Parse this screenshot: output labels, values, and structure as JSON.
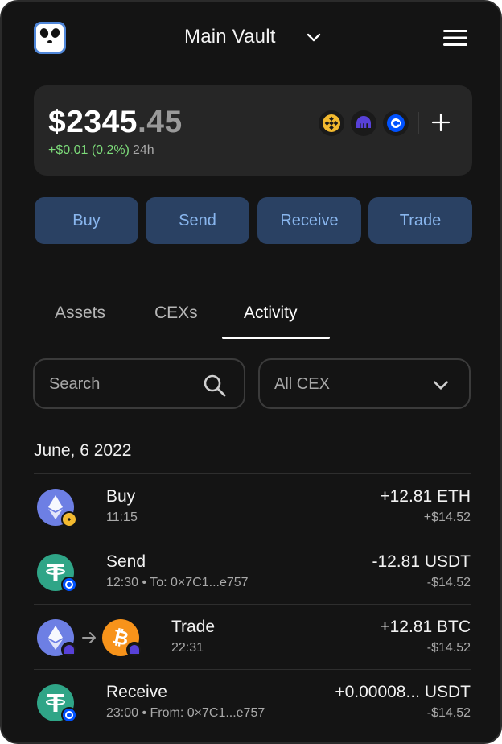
{
  "header": {
    "title": "Main Vault",
    "logo_icon": "panda-logo-icon",
    "menu_icon": "hamburger-menu-icon"
  },
  "balance": {
    "whole": "$2345",
    "cents": ".45",
    "change": "+$0.01 (0.2%)",
    "period": "24h",
    "exchanges": [
      "binance-icon",
      "kraken-icon",
      "coinbase-icon"
    ]
  },
  "actions": {
    "buy": "Buy",
    "send": "Send",
    "receive": "Receive",
    "trade": "Trade"
  },
  "tabs": [
    {
      "label": "Assets"
    },
    {
      "label": "CEXs"
    },
    {
      "label": "Activity",
      "active": true
    }
  ],
  "filters": {
    "search_placeholder": "Search",
    "cex_selected": "All CEX"
  },
  "activity": {
    "date": "June, 6 2022",
    "items": [
      {
        "type": "Buy",
        "time": "11:15",
        "amount": "+12.81 ETH",
        "fiat": "+$14.52",
        "coin": "ethereum-icon",
        "exchange": "binance-icon"
      },
      {
        "type": "Send",
        "time": "12:30 • To: 0×7C1...e757",
        "amount": "-12.81 USDT",
        "fiat": "-$14.52",
        "coin": "tether-icon",
        "exchange": "coinbase-icon"
      },
      {
        "type": "Trade",
        "time": "22:31",
        "amount": "+12.81 BTC",
        "fiat": "-$14.52",
        "coin": "ethereum-icon",
        "to_coin": "bitcoin-icon",
        "exchange": "kraken-icon"
      },
      {
        "type": "Receive",
        "time": "23:00 • From: 0×7C1...e757",
        "amount": "+0.00008... USDT",
        "fiat": "-$14.52",
        "coin": "tether-icon",
        "exchange": "coinbase-icon"
      }
    ]
  },
  "colors": {
    "background": "#141414",
    "card": "#262626",
    "action_bg": "#2a4163",
    "action_text": "#89b6ee",
    "positive": "#7ddc7a",
    "ethereum": "#6d7fe4",
    "tether": "#2fa587",
    "bitcoin": "#f7931a",
    "binance": "#f3ba2f",
    "coinbase": "#0052ff",
    "kraken": "#5841d8"
  }
}
